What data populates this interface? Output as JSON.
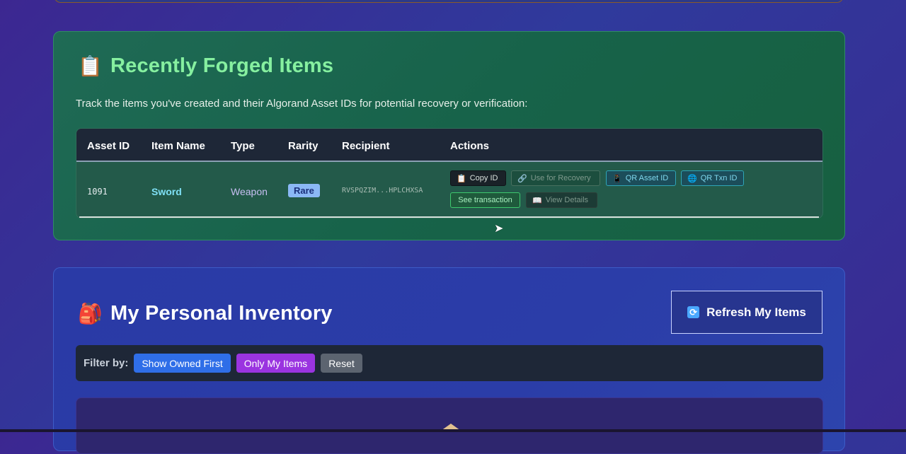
{
  "forged": {
    "icon": "clipboard-icon",
    "title": "Recently Forged Items",
    "description": "Track the items you've created and their Algorand Asset IDs for potential recovery or verification:",
    "columns": [
      "Asset ID",
      "Item Name",
      "Type",
      "Rarity",
      "Recipient",
      "Actions"
    ],
    "rows": [
      {
        "asset_id": "1091",
        "item_name": "Sword",
        "type": "Weapon",
        "rarity": "Rare",
        "recipient": "RVSPQZIM...HPLCHXSA",
        "actions": {
          "copy_id": "Copy ID",
          "use_for_recovery": "Use for Recovery",
          "qr_asset_id": "QR Asset ID",
          "qr_txn_id": "QR Txn ID",
          "see_transaction": "See transaction",
          "view_details": "View Details"
        }
      }
    ]
  },
  "inventory": {
    "icon": "backpack-icon",
    "title": "My Personal Inventory",
    "refresh_label": "Refresh My Items",
    "filter_label": "Filter by:",
    "filters": [
      "Show Owned First",
      "Only My Items",
      "Reset"
    ]
  },
  "colors": {
    "forged_title": "#86f0a0",
    "filter_owned": "#2f6ee8",
    "filter_mine": "#9a34e0",
    "filter_reset": "#5c6470"
  }
}
